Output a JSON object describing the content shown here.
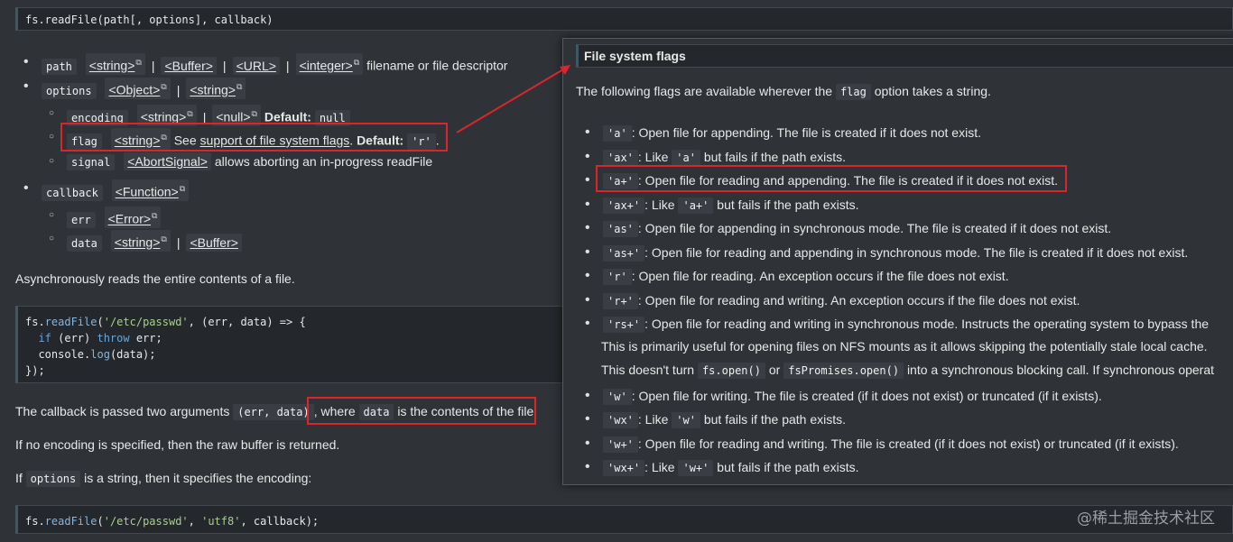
{
  "signature": "fs.readFile(path[, options], callback)",
  "params": [
    {
      "name": "path",
      "types": [
        "<string>",
        "<Buffer>",
        "<URL>",
        "<integer>"
      ],
      "desc": "filename or file descriptor"
    },
    {
      "name": "options",
      "types": [
        "<Object>",
        "<string>"
      ]
    },
    {
      "name": "encoding",
      "types": [
        "<string>",
        "<null>"
      ],
      "default_label": "Default:",
      "default": "null"
    },
    {
      "name": "flag",
      "types": [
        "<string>"
      ],
      "see": "See",
      "link": "support of file system flags",
      "default_label": "Default:",
      "default": "'r'",
      "end": "."
    },
    {
      "name": "signal",
      "types": [
        "<AbortSignal>"
      ],
      "desc": "allows aborting an in-progress readFile"
    },
    {
      "name": "callback",
      "types": [
        "<Function>"
      ]
    },
    {
      "name": "err",
      "types": [
        "<Error>"
      ]
    },
    {
      "name": "data",
      "types": [
        "<string>",
        "<Buffer>"
      ]
    }
  ],
  "desc1": "Asynchronously reads the entire contents of a file.",
  "code1": {
    "l1a": "fs.",
    "l1b": "readFile",
    "l1c": "(",
    "l1d": "'/etc/passwd'",
    "l1e": ", (err, data) => {",
    "l2a": "  ",
    "l2b": "if",
    "l2c": " (err) ",
    "l2d": "throw",
    "l2e": " err;",
    "l3a": "  console.",
    "l3b": "log",
    "l3c": "(data);",
    "l4": "});"
  },
  "callback_para": {
    "a": "The callback is passed two arguments",
    "code": "(err, data)",
    "b": ", where",
    "code2": "data",
    "c": "is the contents of the file."
  },
  "no_encoding": "If no encoding is specified, then the raw buffer is returned.",
  "options_para": {
    "a": "If",
    "code": "options",
    "b": "is a string, then it specifies the encoding:"
  },
  "code2": {
    "a": "fs.",
    "b": "readFile",
    "c": "(",
    "d": "'/etc/passwd'",
    "e": ", ",
    "f": "'utf8'",
    "g": ", callback);"
  },
  "popup": {
    "title": "File system flags",
    "intro_a": "The following flags are available wherever the",
    "intro_code": "flag",
    "intro_b": "option takes a string.",
    "flags": [
      {
        "code": "'a'",
        "text": ": Open file for appending. The file is created if it does not exist."
      },
      {
        "code": "'ax'",
        "text": ": Like",
        "code2": "'a'",
        "text2": "but fails if the path exists."
      },
      {
        "code": "'a+'",
        "text": ": Open file for reading and appending. The file is created if it does not exist."
      },
      {
        "code": "'ax+'",
        "text": ": Like",
        "code2": "'a+'",
        "text2": "but fails if the path exists."
      },
      {
        "code": "'as'",
        "text": ": Open file for appending in synchronous mode. The file is created if it does not exist."
      },
      {
        "code": "'as+'",
        "text": ": Open file for reading and appending in synchronous mode. The file is created if it does not exist."
      },
      {
        "code": "'r'",
        "text": ": Open file for reading. An exception occurs if the file does not exist."
      },
      {
        "code": "'r+'",
        "text": ": Open file for reading and writing. An exception occurs if the file does not exist."
      },
      {
        "code": "'rs+'",
        "text": ": Open file for reading and writing in synchronous mode. Instructs the operating system to bypass the"
      },
      {
        "code": "'w'",
        "text": ": Open file for writing. The file is created (if it does not exist) or truncated (if it exists)."
      },
      {
        "code": "'wx'",
        "text": ": Like",
        "code2": "'w'",
        "text2": "but fails if the path exists."
      },
      {
        "code": "'w+'",
        "text": ": Open file for reading and writing. The file is created (if it does not exist) or truncated (if it exists)."
      },
      {
        "code": "'wx+'",
        "text": ": Like",
        "code2": "'w+'",
        "text2": "but fails if the path exists."
      }
    ],
    "rs_cont1": "This is primarily useful for opening files on NFS mounts as it allows skipping the potentially stale local cache.",
    "rs_cont2_a": "This doesn't turn",
    "rs_cont2_code1": "fs.open()",
    "rs_cont2_or": "or",
    "rs_cont2_code2": "fsPromises.open()",
    "rs_cont2_b": "into a synchronous blocking call. If synchronous operat"
  },
  "watermark": "@稀土掘金技术社区",
  "colors": {
    "highlight": "#d9262c",
    "background": "#2f3237",
    "code_bg": "#24272b"
  }
}
